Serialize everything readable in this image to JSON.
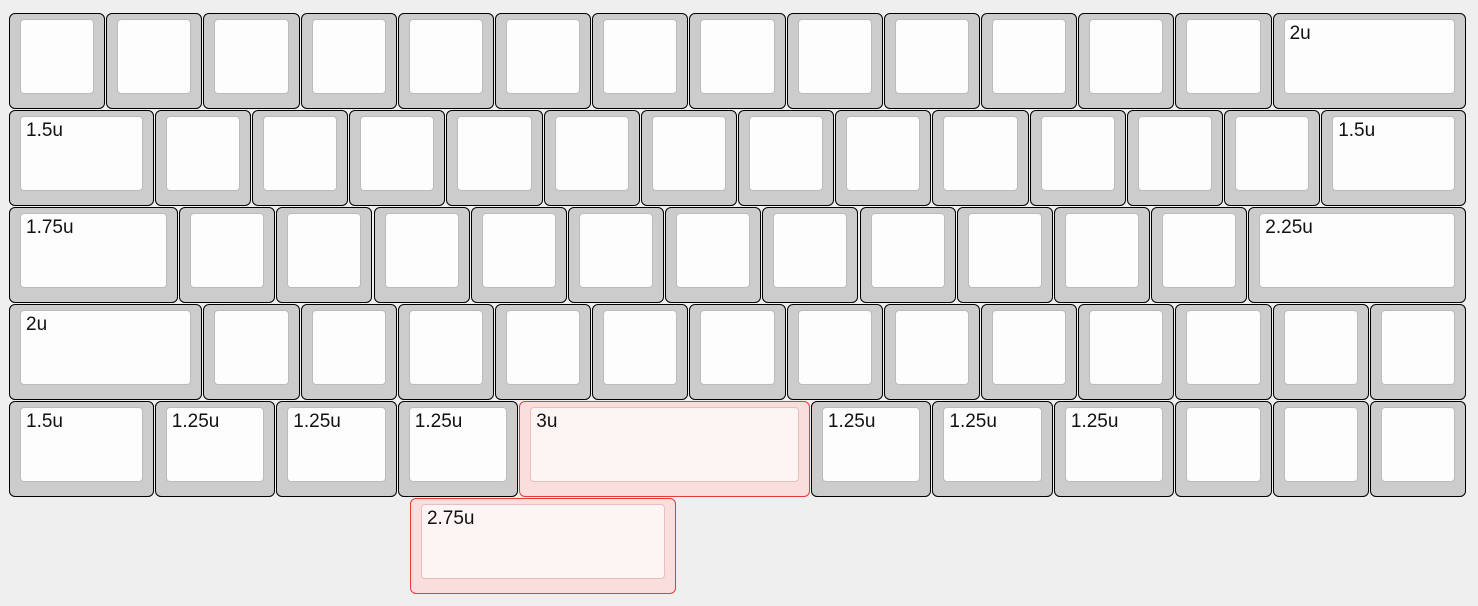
{
  "colors": {
    "background": "#efefef",
    "key_side": "#cccccc",
    "key_top": "#fdfdfd",
    "key_border": "#000000",
    "alt_key_side": "#fadede",
    "alt_key_border": "#e23c3c"
  },
  "rows": [
    {
      "keys": [
        {
          "w": 1,
          "label": ""
        },
        {
          "w": 1,
          "label": ""
        },
        {
          "w": 1,
          "label": ""
        },
        {
          "w": 1,
          "label": ""
        },
        {
          "w": 1,
          "label": ""
        },
        {
          "w": 1,
          "label": ""
        },
        {
          "w": 1,
          "label": ""
        },
        {
          "w": 1,
          "label": ""
        },
        {
          "w": 1,
          "label": ""
        },
        {
          "w": 1,
          "label": ""
        },
        {
          "w": 1,
          "label": ""
        },
        {
          "w": 1,
          "label": ""
        },
        {
          "w": 1,
          "label": ""
        },
        {
          "w": 2,
          "label": "2u"
        }
      ]
    },
    {
      "keys": [
        {
          "w": 1.5,
          "label": "1.5u"
        },
        {
          "w": 1,
          "label": ""
        },
        {
          "w": 1,
          "label": ""
        },
        {
          "w": 1,
          "label": ""
        },
        {
          "w": 1,
          "label": ""
        },
        {
          "w": 1,
          "label": ""
        },
        {
          "w": 1,
          "label": ""
        },
        {
          "w": 1,
          "label": ""
        },
        {
          "w": 1,
          "label": ""
        },
        {
          "w": 1,
          "label": ""
        },
        {
          "w": 1,
          "label": ""
        },
        {
          "w": 1,
          "label": ""
        },
        {
          "w": 1,
          "label": ""
        },
        {
          "w": 1.5,
          "label": "1.5u"
        }
      ]
    },
    {
      "keys": [
        {
          "w": 1.75,
          "label": "1.75u"
        },
        {
          "w": 1,
          "label": ""
        },
        {
          "w": 1,
          "label": ""
        },
        {
          "w": 1,
          "label": ""
        },
        {
          "w": 1,
          "label": ""
        },
        {
          "w": 1,
          "label": ""
        },
        {
          "w": 1,
          "label": ""
        },
        {
          "w": 1,
          "label": ""
        },
        {
          "w": 1,
          "label": ""
        },
        {
          "w": 1,
          "label": ""
        },
        {
          "w": 1,
          "label": ""
        },
        {
          "w": 1,
          "label": ""
        },
        {
          "w": 2.25,
          "label": "2.25u"
        }
      ]
    },
    {
      "keys": [
        {
          "w": 2,
          "label": "2u"
        },
        {
          "w": 1,
          "label": ""
        },
        {
          "w": 1,
          "label": ""
        },
        {
          "w": 1,
          "label": ""
        },
        {
          "w": 1,
          "label": ""
        },
        {
          "w": 1,
          "label": ""
        },
        {
          "w": 1,
          "label": ""
        },
        {
          "w": 1,
          "label": ""
        },
        {
          "w": 1,
          "label": ""
        },
        {
          "w": 1,
          "label": ""
        },
        {
          "w": 1,
          "label": ""
        },
        {
          "w": 1,
          "label": ""
        },
        {
          "w": 1,
          "label": ""
        },
        {
          "w": 1,
          "label": ""
        }
      ]
    },
    {
      "keys": [
        {
          "w": 1.5,
          "label": "1.5u"
        },
        {
          "w": 1.25,
          "label": "1.25u"
        },
        {
          "w": 1.25,
          "label": "1.25u"
        },
        {
          "w": 1.25,
          "label": "1.25u"
        },
        {
          "w": 3,
          "label": "3u",
          "alt": true
        },
        {
          "w": 1.25,
          "label": "1.25u"
        },
        {
          "w": 1.25,
          "label": "1.25u"
        },
        {
          "w": 1.25,
          "label": "1.25u"
        },
        {
          "w": 1,
          "label": ""
        },
        {
          "w": 1,
          "label": ""
        },
        {
          "w": 1,
          "label": ""
        }
      ]
    },
    {
      "offset": 4.125,
      "keys": [
        {
          "w": 2.75,
          "label": "2.75u",
          "alt": true
        }
      ]
    }
  ]
}
